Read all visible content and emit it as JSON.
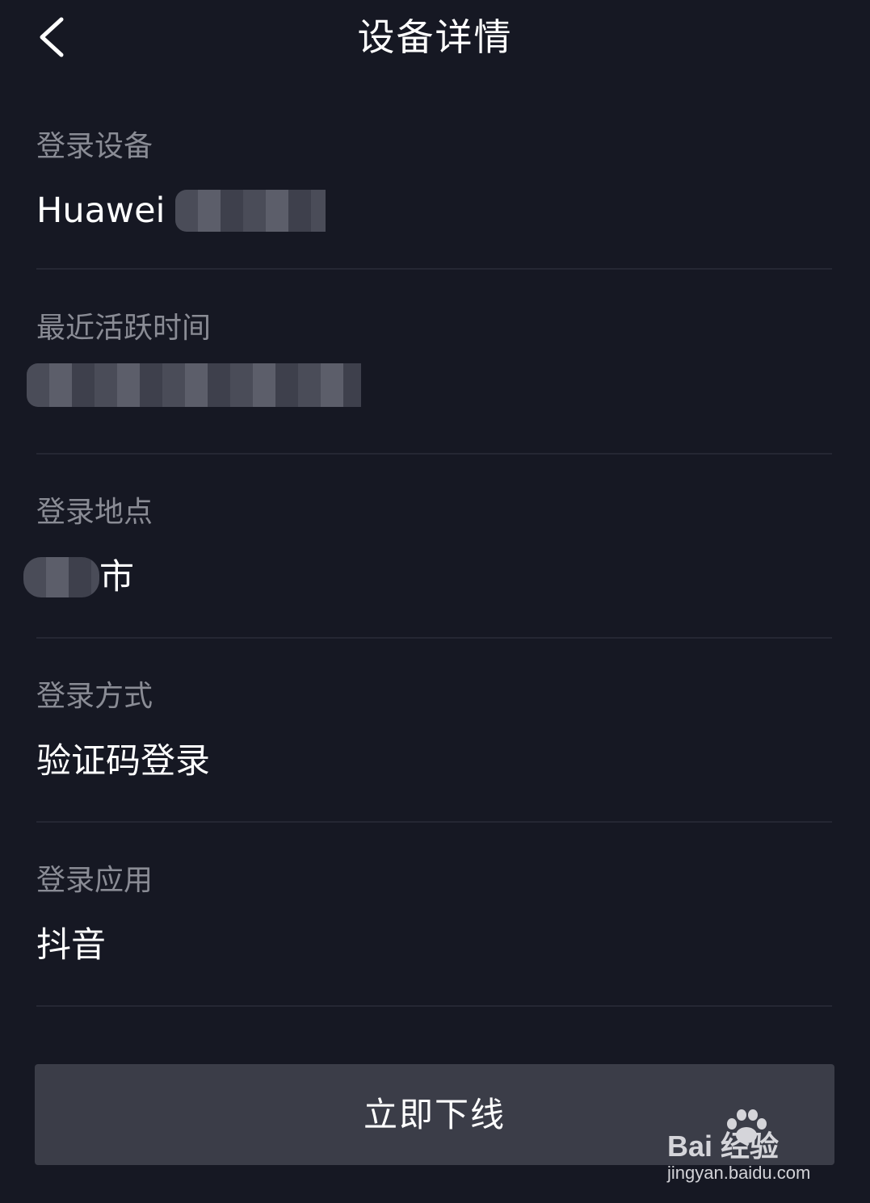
{
  "header": {
    "title": "设备详情",
    "back_icon": "chevron-left-icon"
  },
  "rows": [
    {
      "label": "登录设备",
      "value": "Huawei",
      "redacted": true
    },
    {
      "label": "最近活跃时间",
      "value": "",
      "redacted": true
    },
    {
      "label": "登录地点",
      "value": "市",
      "redacted": true
    },
    {
      "label": "登录方式",
      "value": "验证码登录",
      "redacted": false
    },
    {
      "label": "登录应用",
      "value": "抖音",
      "redacted": false
    }
  ],
  "actions": {
    "offline_label": "立即下线"
  },
  "watermark": {
    "logo_text": "Bai 经验",
    "url": "jingyan.baidu.com"
  },
  "colors": {
    "background": "#161823",
    "label_text": "#8a8c95",
    "value_text": "#ffffff",
    "divider": "#252733",
    "button_bg": "#3b3d48"
  }
}
